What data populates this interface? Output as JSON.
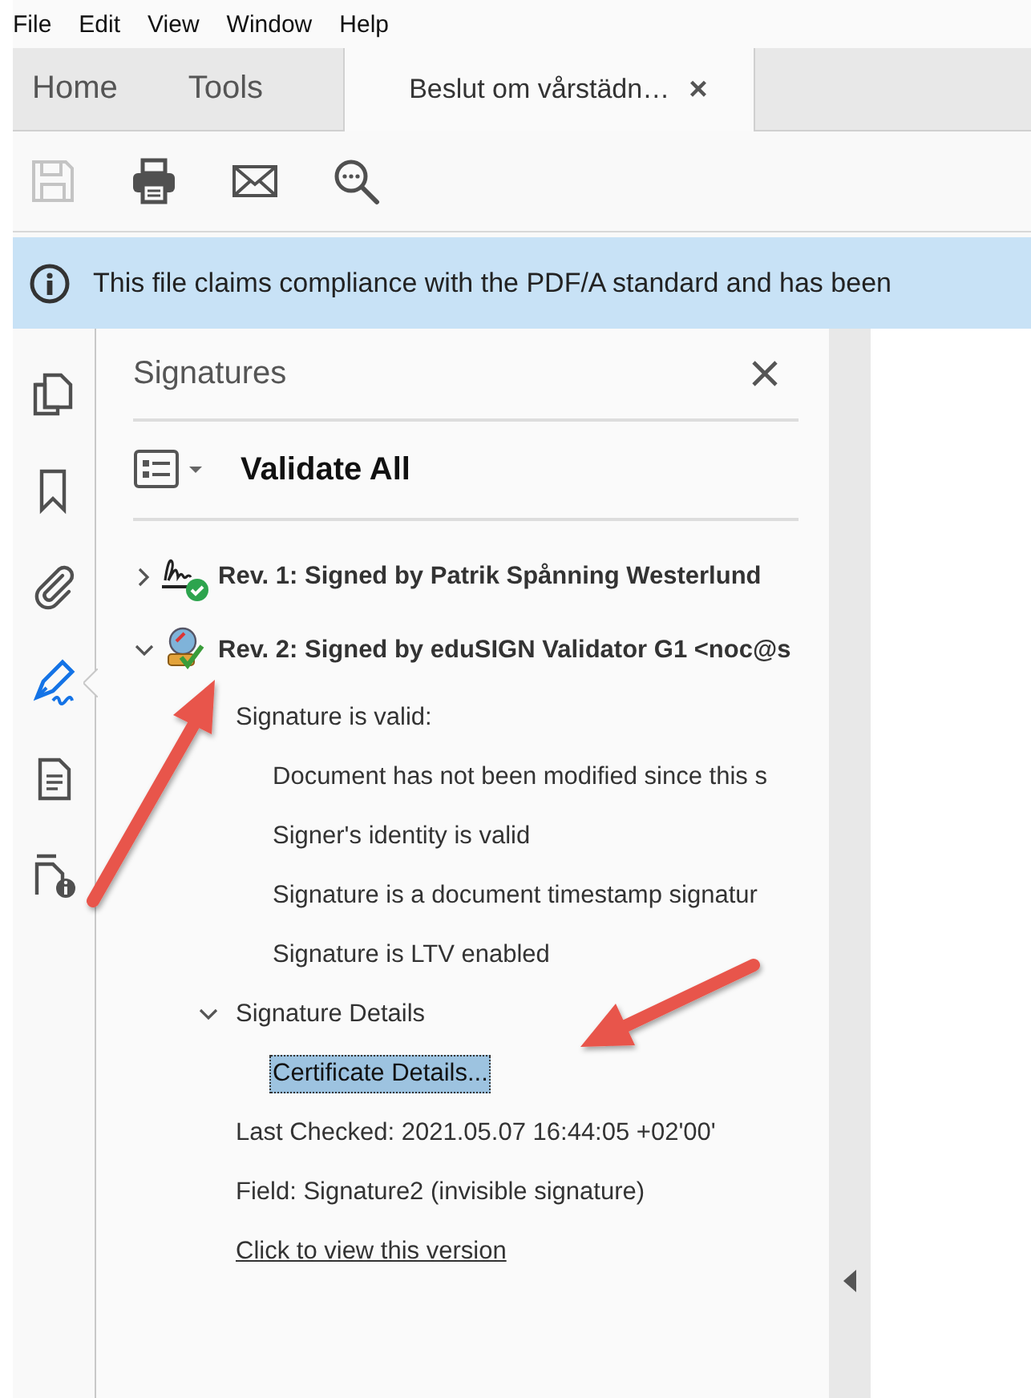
{
  "menu": [
    "File",
    "Edit",
    "View",
    "Window",
    "Help"
  ],
  "tabs": [
    {
      "label": "Home",
      "selected": false,
      "kind": "nav"
    },
    {
      "label": "Tools",
      "selected": false,
      "kind": "nav"
    },
    {
      "label": "Beslut om vårstädn…",
      "selected": true,
      "kind": "document",
      "close": "×"
    }
  ],
  "toolbar": [
    {
      "disabled": true
    },
    {
      "disabled": false
    },
    {
      "disabled": false
    },
    {
      "disabled": false
    }
  ],
  "info_bar": {
    "text": "This file claims compliance with the PDF/A standard and has been"
  },
  "rail": [
    {
      "selected": false
    },
    {
      "selected": false
    },
    {
      "selected": false
    },
    {
      "selected": true
    },
    {
      "selected": false
    },
    {
      "selected": false
    }
  ],
  "panel": {
    "title": "Signatures",
    "validate_label": "Validate All",
    "signatures": [
      {
        "label": "Rev. 1: Signed by Patrik Spånning Westerlund",
        "expanded": false
      },
      {
        "label": "Rev. 2: Signed by eduSIGN Validator G1 <noc@s",
        "expanded": true,
        "children": [
          {
            "label": "Signature is valid:",
            "kind": "group",
            "children": [
              {
                "label": "Document has not been modified since this s",
                "kind": "text"
              },
              {
                "label": "Signer's identity is valid",
                "kind": "text"
              },
              {
                "label": "Signature is a document timestamp signatur",
                "kind": "text"
              },
              {
                "label": "Signature is LTV enabled",
                "kind": "text"
              }
            ]
          },
          {
            "label": "Signature Details",
            "kind": "expander",
            "expanded": true,
            "children": [
              {
                "label": "Certificate Details...",
                "kind": "button",
                "selected": true
              }
            ]
          },
          {
            "label": "Last Checked: 2021.05.07 16:44:05 +02'00'",
            "kind": "text"
          },
          {
            "label": "Field: Signature2 (invisible signature)",
            "kind": "text"
          },
          {
            "label": "Click to view this version",
            "kind": "link"
          }
        ]
      }
    ]
  }
}
